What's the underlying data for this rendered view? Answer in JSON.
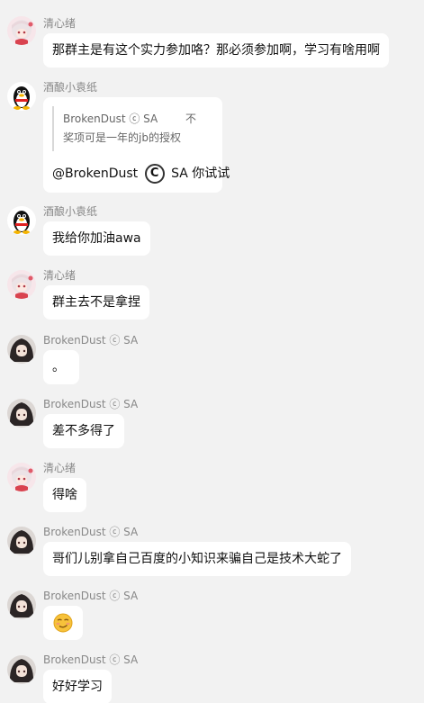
{
  "messages": [
    {
      "sender": "清心绪",
      "text": "那群主是有这个实力参加咯？那必须参加啊，学习有啥用啊"
    },
    {
      "sender": "酒酿小袁纸",
      "quote_author": "BrokenDust ⓒ SA",
      "quote_more": "不",
      "quote_text": "奖项可是一年的jb的授权",
      "mention_prefix": "@BrokenDust",
      "mention_symbol": "C",
      "mention_suffix": "SA 你试试"
    },
    {
      "sender": "酒酿小袁纸",
      "text": "我给你加油awa"
    },
    {
      "sender": "清心绪",
      "text": "群主去不是拿捏"
    },
    {
      "sender": "BrokenDust ⓒ SA",
      "text": "。"
    },
    {
      "sender": "BrokenDust ⓒ SA",
      "text": "差不多得了"
    },
    {
      "sender": "清心绪",
      "text": "得啥"
    },
    {
      "sender": "BrokenDust ⓒ SA",
      "text": "哥们儿别拿自己百度的小知识来骗自己是技术大蛇了"
    },
    {
      "sender": "BrokenDust ⓒ SA",
      "emoji": "smirk-emoji"
    },
    {
      "sender": "BrokenDust ⓒ SA",
      "text": "好好学习"
    }
  ]
}
